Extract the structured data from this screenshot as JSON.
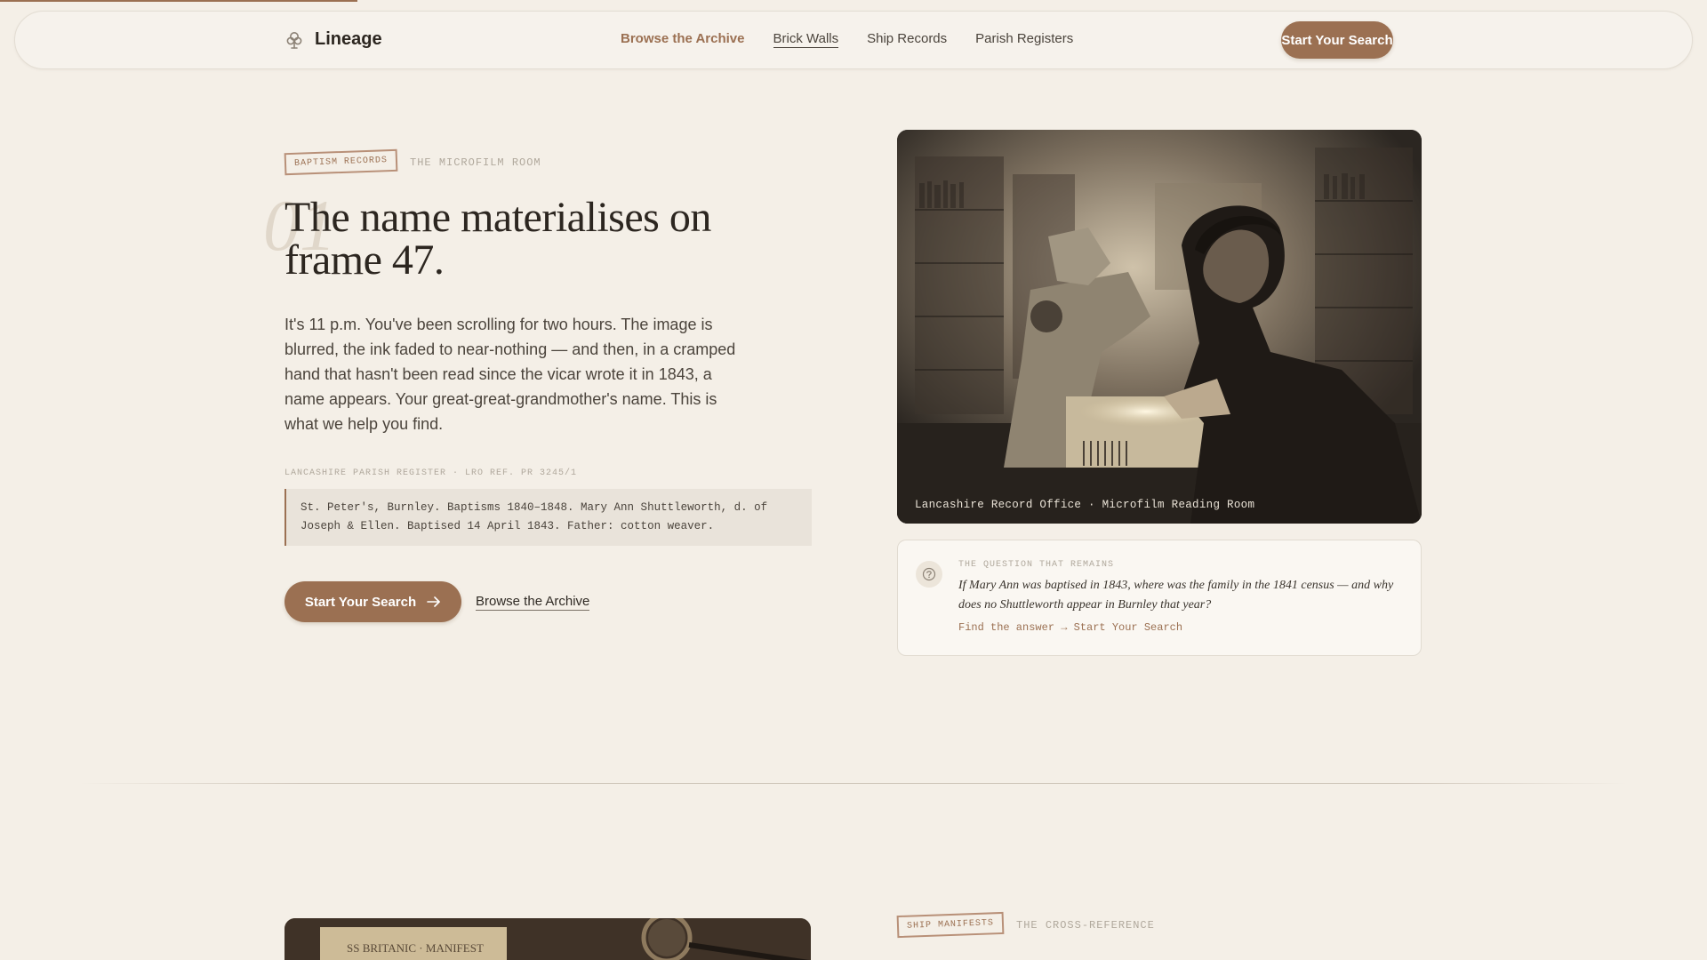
{
  "nav": {
    "brand": "Lineage",
    "links": [
      {
        "label": "Browse the Archive"
      },
      {
        "label": "Brick Walls"
      },
      {
        "label": "Ship Records"
      },
      {
        "label": "Parish Registers"
      }
    ],
    "cta": "Start Your Search"
  },
  "hero": {
    "stamp": "BAPTISM RECORDS",
    "eyebrow": "THE MICROFILM ROOM",
    "index": "01",
    "headline": "The name materialises on frame 47.",
    "lede": "It's 11 p.m. You've been scrolling for two hours. The image is blurred, the ink faded to near-nothing — and then, in a cramped hand that hasn't been read since the vicar wrote it in 1843, a name appears. Your great-great-grandmother's name. This is what we help you find.",
    "ref_label": "LANCASHIRE PARISH REGISTER · LRO REF. PR 3245/1",
    "quote": "St. Peter's, Burnley. Baptisms 1840–1848. Mary Ann Shuttleworth, d. of Joseph & Ellen. Baptised 14 April 1843. Father: cotton weaver.",
    "cta_primary": "Start Your Search",
    "cta_secondary": "Browse the Archive"
  },
  "photo": {
    "caption": "Lancashire Record Office · Microfilm Reading Room"
  },
  "question": {
    "label": "THE QUESTION THAT REMAINS",
    "text": "If Mary Ann was baptised in 1843, where was the family in the 1841 census — and why does no Shuttleworth appear in Burnley that year?",
    "link": "Find the answer → Start Your Search"
  },
  "section2": {
    "stamp": "SHIP MANIFESTS",
    "eyebrow": "THE CROSS-REFERENCE",
    "image_text": "SS BRITANIC · MANIFEST"
  },
  "colors": {
    "accent": "#9b7052",
    "background": "#f4efe7",
    "ink": "#2c2620"
  }
}
